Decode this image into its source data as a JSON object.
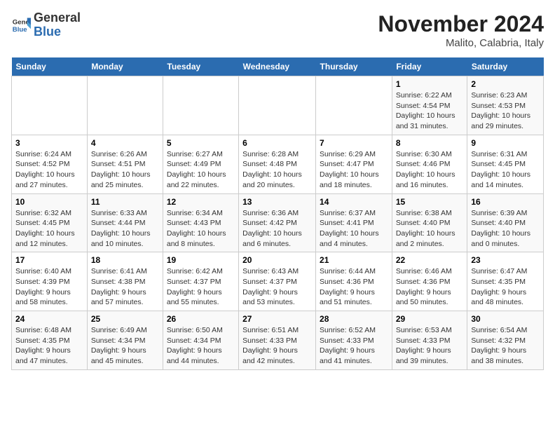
{
  "header": {
    "logo_general": "General",
    "logo_blue": "Blue",
    "month_title": "November 2024",
    "subtitle": "Malito, Calabria, Italy"
  },
  "days_of_week": [
    "Sunday",
    "Monday",
    "Tuesday",
    "Wednesday",
    "Thursday",
    "Friday",
    "Saturday"
  ],
  "weeks": [
    [
      {
        "day": "",
        "info": ""
      },
      {
        "day": "",
        "info": ""
      },
      {
        "day": "",
        "info": ""
      },
      {
        "day": "",
        "info": ""
      },
      {
        "day": "",
        "info": ""
      },
      {
        "day": "1",
        "info": "Sunrise: 6:22 AM\nSunset: 4:54 PM\nDaylight: 10 hours and 31 minutes."
      },
      {
        "day": "2",
        "info": "Sunrise: 6:23 AM\nSunset: 4:53 PM\nDaylight: 10 hours and 29 minutes."
      }
    ],
    [
      {
        "day": "3",
        "info": "Sunrise: 6:24 AM\nSunset: 4:52 PM\nDaylight: 10 hours and 27 minutes."
      },
      {
        "day": "4",
        "info": "Sunrise: 6:26 AM\nSunset: 4:51 PM\nDaylight: 10 hours and 25 minutes."
      },
      {
        "day": "5",
        "info": "Sunrise: 6:27 AM\nSunset: 4:49 PM\nDaylight: 10 hours and 22 minutes."
      },
      {
        "day": "6",
        "info": "Sunrise: 6:28 AM\nSunset: 4:48 PM\nDaylight: 10 hours and 20 minutes."
      },
      {
        "day": "7",
        "info": "Sunrise: 6:29 AM\nSunset: 4:47 PM\nDaylight: 10 hours and 18 minutes."
      },
      {
        "day": "8",
        "info": "Sunrise: 6:30 AM\nSunset: 4:46 PM\nDaylight: 10 hours and 16 minutes."
      },
      {
        "day": "9",
        "info": "Sunrise: 6:31 AM\nSunset: 4:45 PM\nDaylight: 10 hours and 14 minutes."
      }
    ],
    [
      {
        "day": "10",
        "info": "Sunrise: 6:32 AM\nSunset: 4:45 PM\nDaylight: 10 hours and 12 minutes."
      },
      {
        "day": "11",
        "info": "Sunrise: 6:33 AM\nSunset: 4:44 PM\nDaylight: 10 hours and 10 minutes."
      },
      {
        "day": "12",
        "info": "Sunrise: 6:34 AM\nSunset: 4:43 PM\nDaylight: 10 hours and 8 minutes."
      },
      {
        "day": "13",
        "info": "Sunrise: 6:36 AM\nSunset: 4:42 PM\nDaylight: 10 hours and 6 minutes."
      },
      {
        "day": "14",
        "info": "Sunrise: 6:37 AM\nSunset: 4:41 PM\nDaylight: 10 hours and 4 minutes."
      },
      {
        "day": "15",
        "info": "Sunrise: 6:38 AM\nSunset: 4:40 PM\nDaylight: 10 hours and 2 minutes."
      },
      {
        "day": "16",
        "info": "Sunrise: 6:39 AM\nSunset: 4:40 PM\nDaylight: 10 hours and 0 minutes."
      }
    ],
    [
      {
        "day": "17",
        "info": "Sunrise: 6:40 AM\nSunset: 4:39 PM\nDaylight: 9 hours and 58 minutes."
      },
      {
        "day": "18",
        "info": "Sunrise: 6:41 AM\nSunset: 4:38 PM\nDaylight: 9 hours and 57 minutes."
      },
      {
        "day": "19",
        "info": "Sunrise: 6:42 AM\nSunset: 4:37 PM\nDaylight: 9 hours and 55 minutes."
      },
      {
        "day": "20",
        "info": "Sunrise: 6:43 AM\nSunset: 4:37 PM\nDaylight: 9 hours and 53 minutes."
      },
      {
        "day": "21",
        "info": "Sunrise: 6:44 AM\nSunset: 4:36 PM\nDaylight: 9 hours and 51 minutes."
      },
      {
        "day": "22",
        "info": "Sunrise: 6:46 AM\nSunset: 4:36 PM\nDaylight: 9 hours and 50 minutes."
      },
      {
        "day": "23",
        "info": "Sunrise: 6:47 AM\nSunset: 4:35 PM\nDaylight: 9 hours and 48 minutes."
      }
    ],
    [
      {
        "day": "24",
        "info": "Sunrise: 6:48 AM\nSunset: 4:35 PM\nDaylight: 9 hours and 47 minutes."
      },
      {
        "day": "25",
        "info": "Sunrise: 6:49 AM\nSunset: 4:34 PM\nDaylight: 9 hours and 45 minutes."
      },
      {
        "day": "26",
        "info": "Sunrise: 6:50 AM\nSunset: 4:34 PM\nDaylight: 9 hours and 44 minutes."
      },
      {
        "day": "27",
        "info": "Sunrise: 6:51 AM\nSunset: 4:33 PM\nDaylight: 9 hours and 42 minutes."
      },
      {
        "day": "28",
        "info": "Sunrise: 6:52 AM\nSunset: 4:33 PM\nDaylight: 9 hours and 41 minutes."
      },
      {
        "day": "29",
        "info": "Sunrise: 6:53 AM\nSunset: 4:33 PM\nDaylight: 9 hours and 39 minutes."
      },
      {
        "day": "30",
        "info": "Sunrise: 6:54 AM\nSunset: 4:32 PM\nDaylight: 9 hours and 38 minutes."
      }
    ]
  ]
}
